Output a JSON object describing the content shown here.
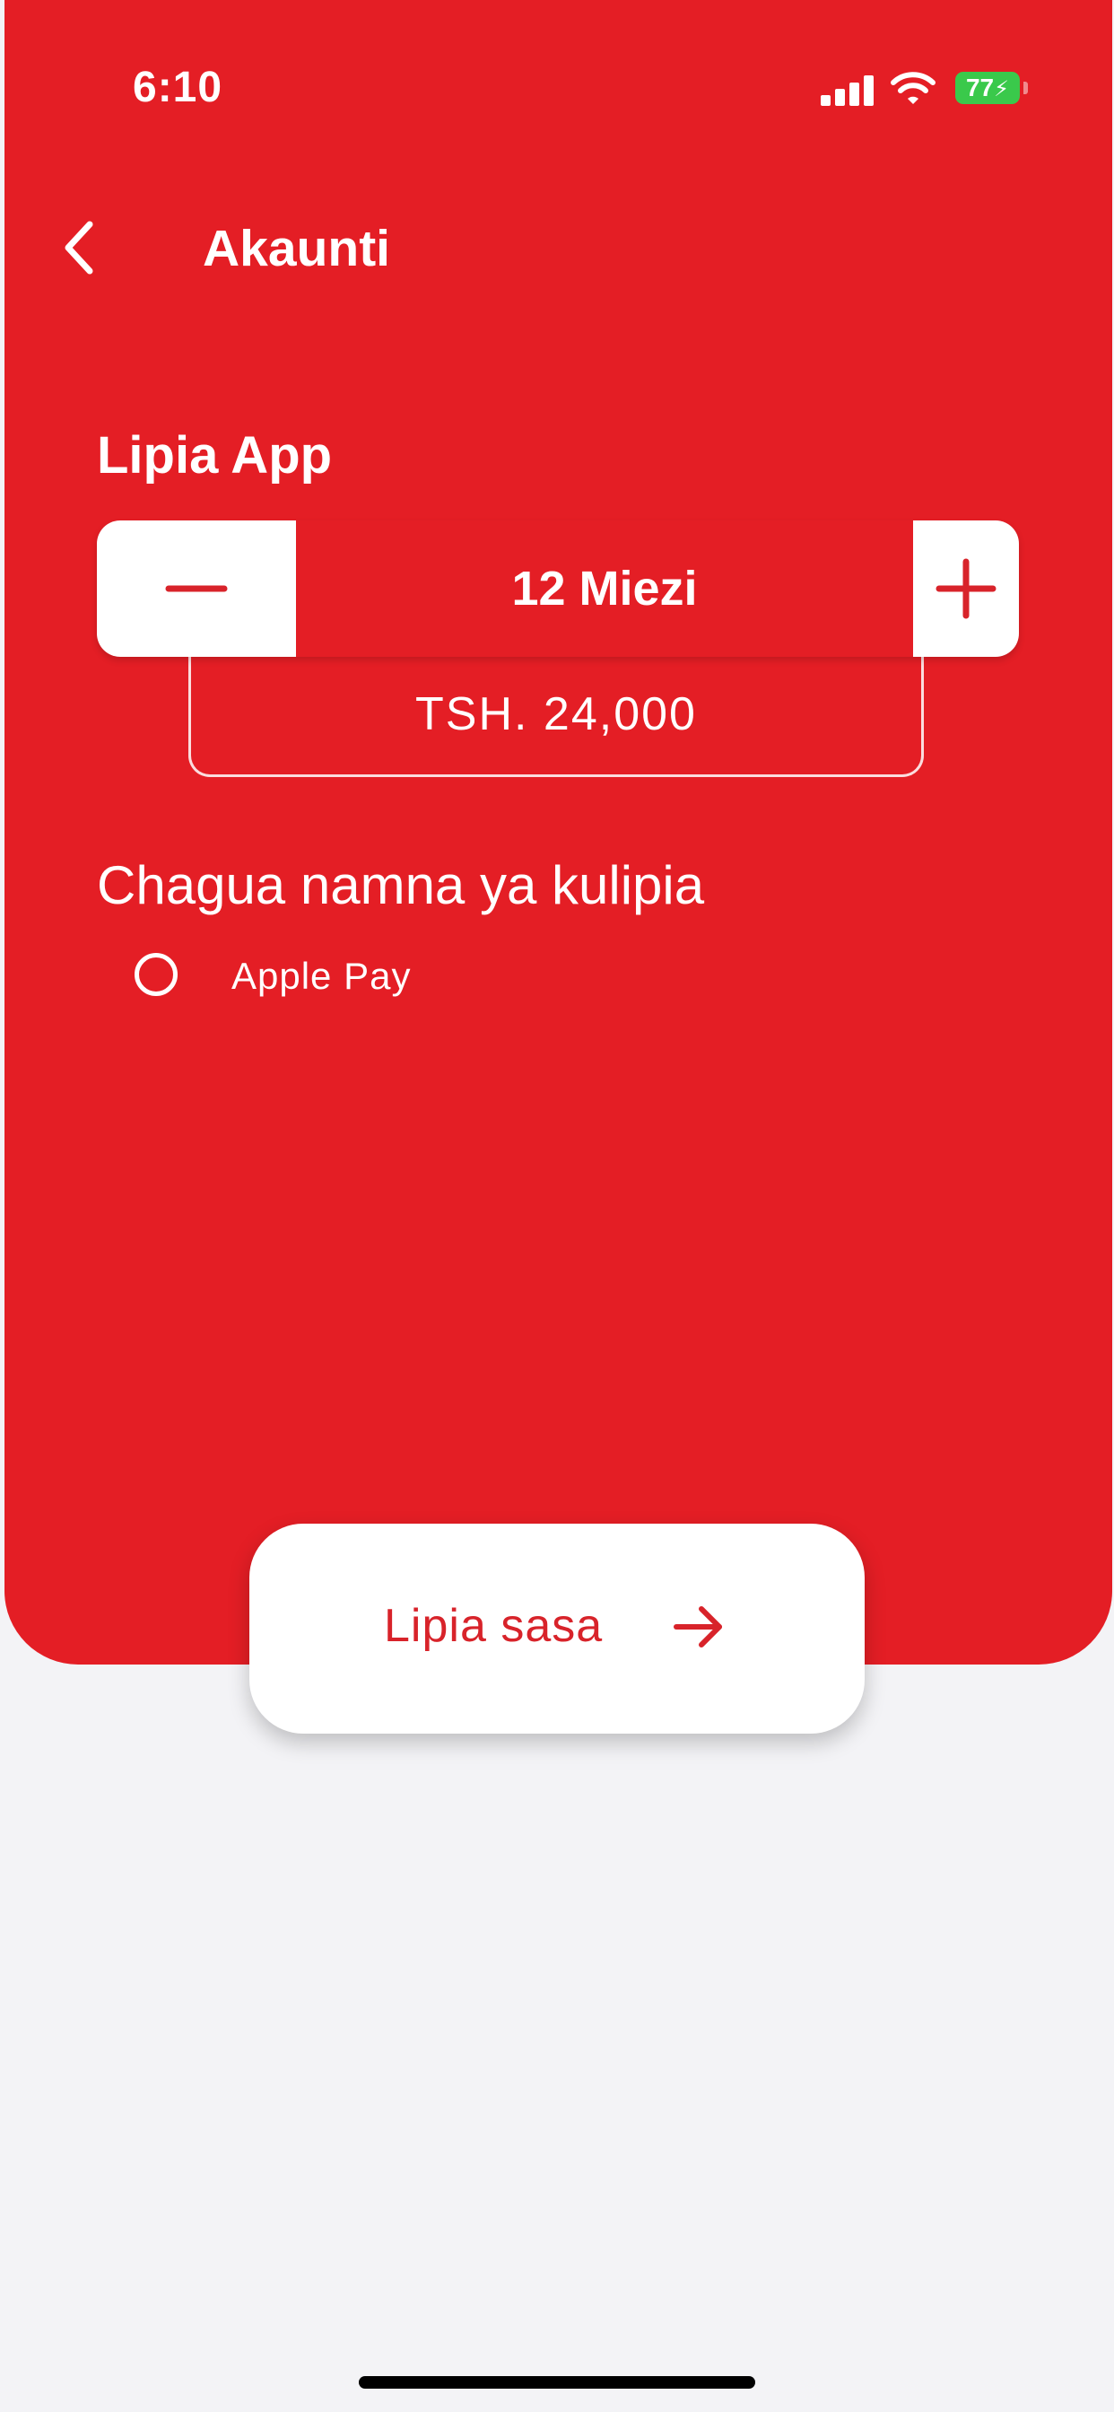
{
  "status_bar": {
    "time": "6:10",
    "battery": "77",
    "icons": [
      "signal-icon",
      "wifi-icon",
      "battery-charging-icon"
    ]
  },
  "header": {
    "title": "Akaunti",
    "back_icon": "chevron-left-icon"
  },
  "subscription": {
    "title": "Lipia App",
    "duration": "12 Miezi",
    "price": "TSH.  24,000",
    "decrease_icon": "minus-icon",
    "increase_icon": "plus-icon"
  },
  "payment": {
    "title": "Chagua namna ya kulipia",
    "options": [
      {
        "label": "Apple Pay",
        "selected": false
      }
    ]
  },
  "action": {
    "label": "Lipia sasa",
    "icon": "arrow-right-icon"
  },
  "colors": {
    "brand_red": "#e41e25",
    "background": "#f3f3f6",
    "battery_green": "#3ac94b"
  }
}
